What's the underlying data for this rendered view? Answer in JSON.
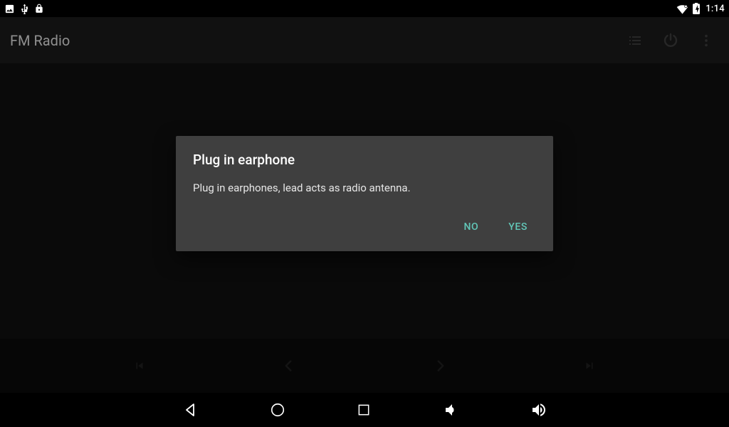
{
  "status_bar": {
    "time": "1:14"
  },
  "action_bar": {
    "title": "FM Radio"
  },
  "dialog": {
    "title": "Plug in earphone",
    "message": "Plug in earphones, lead acts as radio antenna.",
    "negative": "NO",
    "positive": "YES"
  }
}
